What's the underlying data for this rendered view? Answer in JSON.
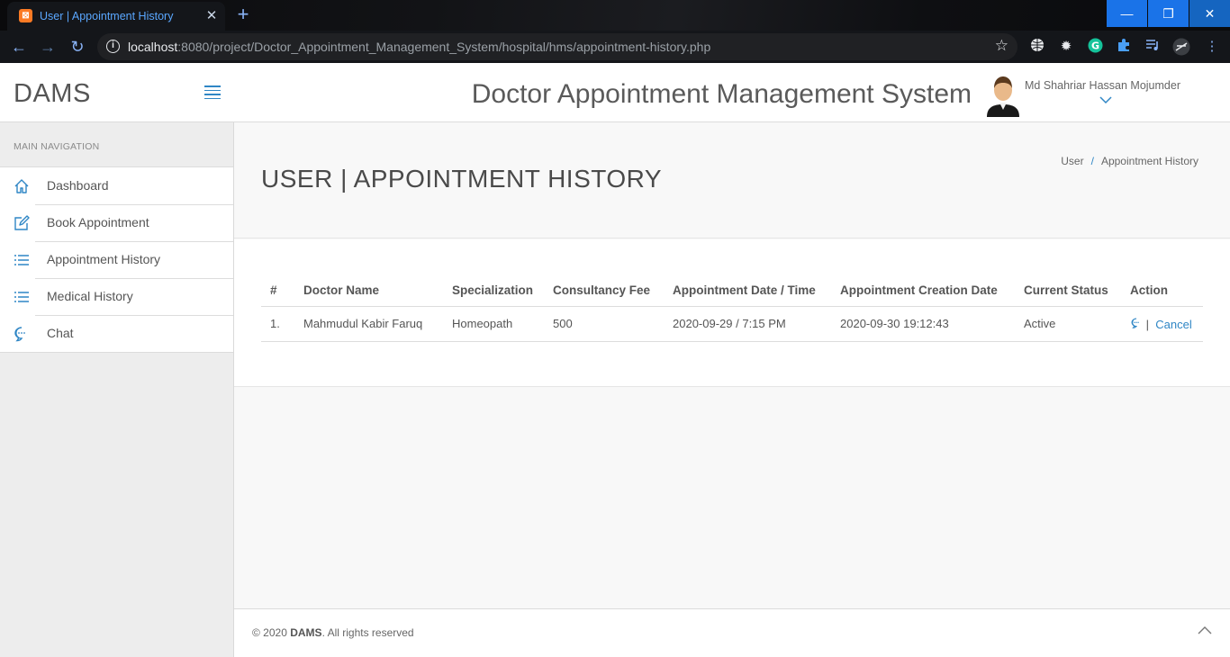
{
  "browser": {
    "tab_title": "User | Appointment History",
    "tab_close": "✕",
    "new_tab": "+",
    "url_host": "localhost",
    "url_rest": ":8080/project/Doctor_Appointment_Management_System/hospital/hms/appointment-history.php",
    "window_controls": {
      "minimize": "—",
      "restore": "❐",
      "close": "✕"
    }
  },
  "sidebar": {
    "brand": "DAMS",
    "nav_title": "MAIN NAVIGATION",
    "items": [
      {
        "label": "Dashboard",
        "icon": "home-icon"
      },
      {
        "label": "Book Appointment",
        "icon": "edit-icon"
      },
      {
        "label": "Appointment History",
        "icon": "list-icon"
      },
      {
        "label": "Medical History",
        "icon": "list-icon"
      },
      {
        "label": "Chat",
        "icon": "chat-icon"
      }
    ]
  },
  "header": {
    "system_title": "Doctor Appointment Management System",
    "user_name": "Md Shahriar Hassan Mojumder"
  },
  "page": {
    "heading": "USER | APPOINTMENT HISTORY",
    "breadcrumb": [
      "User",
      "Appointment History"
    ],
    "breadcrumb_separator": "/"
  },
  "table": {
    "columns": [
      "#",
      "Doctor Name",
      "Specialization",
      "Consultancy Fee",
      "Appointment Date / Time",
      "Appointment Creation Date",
      "Current Status",
      "Action"
    ],
    "rows": [
      {
        "index": "1.",
        "doctor": "Mahmudul Kabir Faruq",
        "specialization": "Homeopath",
        "fee": "500",
        "appointment": "2020-09-29 / 7:15 PM",
        "created": "2020-09-30 19:12:43",
        "status": "Active",
        "action_sep": "|",
        "action_cancel": "Cancel"
      }
    ]
  },
  "footer": {
    "prefix": "© 2020 ",
    "brand": "DAMS",
    "suffix": ". All rights reserved"
  },
  "colors": {
    "accent": "#2f86c5",
    "browser_link": "#5aa7ff"
  }
}
